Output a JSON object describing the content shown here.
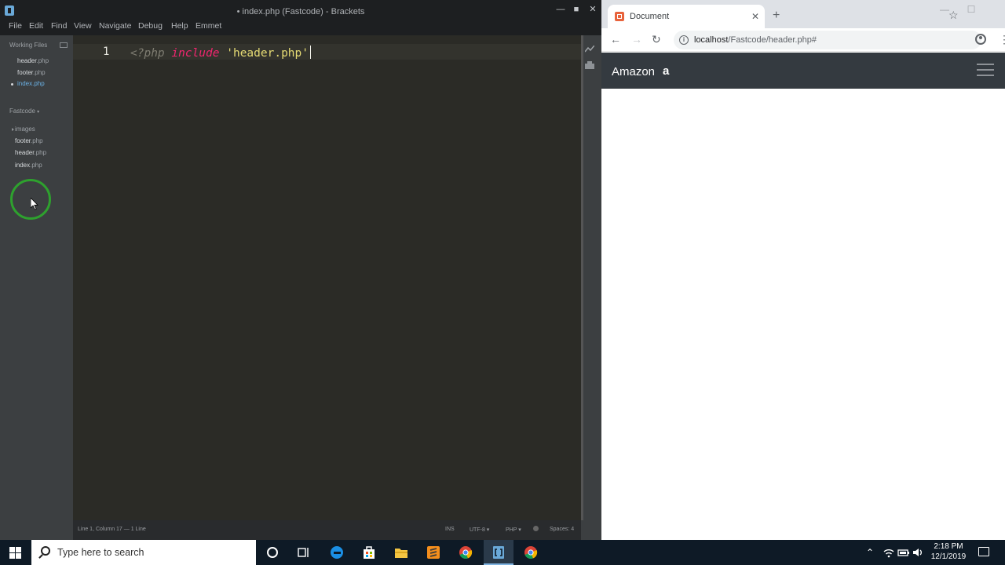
{
  "brackets": {
    "title": "• index.php (Fastcode) - Brackets",
    "menu": [
      "File",
      "Edit",
      "Find",
      "View",
      "Navigate",
      "Debug",
      "Help",
      "Emmet"
    ],
    "sidebar": {
      "working_files_label": "Working Files",
      "working_files": [
        {
          "name": "header",
          "ext": ".php"
        },
        {
          "name": "footer",
          "ext": ".php"
        },
        {
          "name": "index",
          "ext": ".php",
          "active": true,
          "modified": true
        }
      ],
      "project_label": "Fastcode",
      "project_tree": [
        {
          "name": "images",
          "ext": "",
          "folder": true
        },
        {
          "name": "footer",
          "ext": ".php"
        },
        {
          "name": "header",
          "ext": ".php"
        },
        {
          "name": "index",
          "ext": ".php"
        }
      ]
    },
    "editor": {
      "line_number": "1",
      "code": {
        "open_tag": "<?php",
        "keyword": "include",
        "string": "'header.php'"
      }
    },
    "status": {
      "cursor": "Line 1, Column 17 — 1 Line",
      "mode": "INS",
      "encoding": "UTF-8",
      "language": "PHP",
      "spaces": "Spaces: 4"
    }
  },
  "browser": {
    "tab_title": "Document",
    "url_host": "localhost",
    "url_path": "/Fastcode/header.php#",
    "site": {
      "brand": "Amazon",
      "brand_icon": "a"
    }
  },
  "taskbar": {
    "search_placeholder": "Type here to search",
    "time": "2:18 PM",
    "date": "12/1/2019"
  },
  "colors": {
    "editor_bg": "#2b2b26",
    "sidebar_bg": "#3c3f41",
    "php_keyword": "#f2266f",
    "php_string": "#e6db74",
    "navbar_bg": "#343a40",
    "taskbar_bg": "#0e1a26"
  }
}
